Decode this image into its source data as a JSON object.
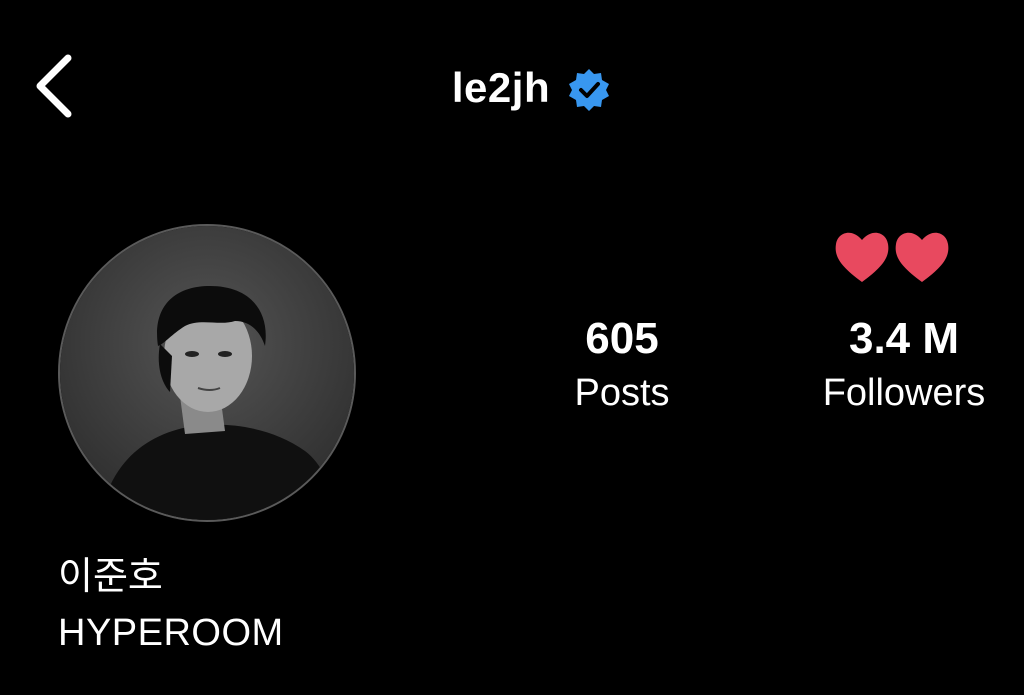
{
  "header": {
    "back_icon": "chevron-left-icon",
    "username": "le2jh",
    "verified_icon": "verified-badge-icon",
    "verified_color": "#3897f0"
  },
  "profile": {
    "avatar_alt": "profile photo",
    "emoji": "two-hearts",
    "heart_color": "#e8495f",
    "stats": {
      "posts_value": "605",
      "posts_label": "Posts",
      "followers_value": "3.4 M",
      "followers_label": "Followers"
    },
    "bio": {
      "name": "이준호",
      "text": "HYPEROOM"
    }
  },
  "theme": {
    "background": "#000000",
    "text": "#ffffff"
  }
}
